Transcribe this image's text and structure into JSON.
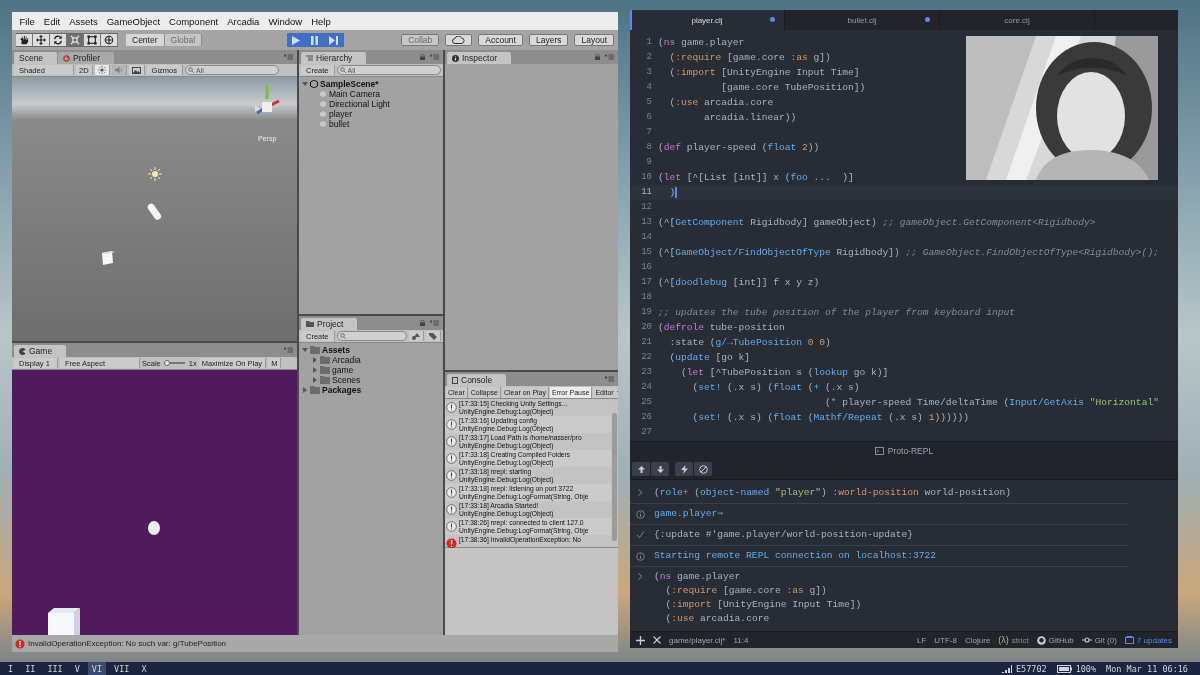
{
  "unity": {
    "menu": [
      "File",
      "Edit",
      "Assets",
      "GameObject",
      "Component",
      "Arcadia",
      "Window",
      "Help"
    ],
    "tools": [
      {
        "kind": "hand",
        "selected": false
      },
      {
        "kind": "move",
        "selected": false
      },
      {
        "kind": "rotate",
        "selected": false
      },
      {
        "kind": "scale",
        "selected": true
      },
      {
        "kind": "rect",
        "selected": false
      },
      {
        "kind": "transform",
        "selected": false
      }
    ],
    "pivot": [
      {
        "label": "Center",
        "disabled": false
      },
      {
        "label": "Global",
        "disabled": true
      }
    ],
    "playback": [
      {
        "kind": "play",
        "on": true
      },
      {
        "kind": "pause",
        "on": true
      },
      {
        "kind": "step",
        "on": true
      }
    ],
    "collab": {
      "label": "Collab",
      "disabled": true
    },
    "account": "Account",
    "layers": "Layers",
    "layout": "Layout",
    "scene": {
      "tabs": [
        {
          "label": "Scene",
          "selected": true
        },
        {
          "label": "Profiler",
          "selected": false
        }
      ],
      "shading": "Shaded",
      "mode_2d": "2D",
      "lighting_on": true,
      "audio_on": false,
      "gizmos": "Gizmos",
      "search": {
        "placeholder": "All"
      },
      "view_label": "Persp"
    },
    "hierarchy": {
      "title": "Hierarchy",
      "create": "Create",
      "search": {
        "placeholder": "All"
      },
      "items": [
        {
          "label": "SampleScene*",
          "expanded": true,
          "children": [
            {
              "label": "Main Camera"
            },
            {
              "label": "Directional Light"
            },
            {
              "label": "player"
            },
            {
              "label": "bullet"
            }
          ]
        }
      ]
    },
    "inspector": {
      "title": "Inspector"
    },
    "game": {
      "title": "Game",
      "display": "Display 1",
      "aspect": "Free Aspect",
      "scale_label": "Scale",
      "scale": {
        "level": 0
      },
      "scale_reading": "1x",
      "maximize": "Maximize On Play",
      "next_toggle": "M"
    },
    "project": {
      "title": "Project",
      "create": "Create",
      "items": [
        {
          "label": "Assets",
          "expanded": true,
          "children": [
            {
              "label": "Arcadia",
              "expanded": false
            },
            {
              "label": "game",
              "expanded": false
            },
            {
              "label": "Scenes",
              "expanded": false
            }
          ]
        },
        {
          "label": "Packages",
          "expanded": false
        }
      ]
    },
    "console": {
      "title": "Console",
      "buttons": [
        {
          "label": "Clear",
          "kind": "button",
          "selected": false
        },
        {
          "label": "Collapse",
          "kind": "button",
          "selected": false
        },
        {
          "label": "Clear on Play",
          "kind": "button",
          "selected": false
        },
        {
          "label": "Error Pause",
          "kind": "button",
          "selected": true
        },
        {
          "label": "Editor",
          "kind": "dropdown",
          "selected": false
        }
      ],
      "entries": [
        {
          "kind": "log",
          "message": "[17:33:15] Checking Unity Settings…",
          "source": "UnityEngine.Debug:Log(Object)"
        },
        {
          "kind": "log",
          "message": "[17:33:16] Updating config",
          "source": "UnityEngine.Debug:Log(Object)"
        },
        {
          "kind": "log",
          "message": "[17:33:17] Load Path is /home/nasser/pro",
          "source": "UnityEngine.Debug:Log(Object)"
        },
        {
          "kind": "log",
          "message": "[17:33:18] Creating Compiled Folders",
          "source": "UnityEngine.Debug:Log(Object)"
        },
        {
          "kind": "log",
          "message": "[17:33:18] nrepl: starting",
          "source": "UnityEngine.Debug:Log(Object)"
        },
        {
          "kind": "log",
          "message": "[17:33:18] nrepl: listening on port 3722",
          "source": "UnityEngine.Debug:LogFormat(String, Obje"
        },
        {
          "kind": "log",
          "message": "[17:33:18] Arcadia Started!",
          "source": "UnityEngine.Debug:Log(Object)"
        },
        {
          "kind": "log",
          "message": "[17:38:26] nrepl: connected to client 127.0",
          "source": "UnityEngine.Debug:LogFormat(String, Obje"
        },
        {
          "kind": "error",
          "message": "[17:38:36] InvalidOperationException: No"
        }
      ]
    },
    "status": {
      "kind": "error",
      "message": "InvalidOperationException: No such var: g/TubePosition"
    }
  },
  "atom": {
    "tabs": [
      {
        "label": "player.clj",
        "selected": true,
        "modified": true
      },
      {
        "label": "bullet.clj",
        "selected": false,
        "modified": true
      },
      {
        "label": "core.clj",
        "selected": false,
        "modified": false
      }
    ],
    "lines": [
      {
        "number": "1",
        "current": false,
        "tokens": [
          {
            "text": "(",
            "kind": "plain"
          },
          {
            "text": "ns",
            "kind": "keyword"
          },
          {
            "text": " game.player",
            "kind": "plain"
          }
        ]
      },
      {
        "number": "2",
        "current": false,
        "tokens": [
          {
            "text": "  (",
            "kind": "plain"
          },
          {
            "text": ":require",
            "kind": "symbol"
          },
          {
            "text": " [game.core ",
            "kind": "plain"
          },
          {
            "text": ":as",
            "kind": "symbol"
          },
          {
            "text": " g])",
            "kind": "plain"
          }
        ]
      },
      {
        "number": "3",
        "current": false,
        "tokens": [
          {
            "text": "  (",
            "kind": "plain"
          },
          {
            "text": ":import",
            "kind": "symbol"
          },
          {
            "text": " [UnityEngine Input Time]",
            "kind": "plain"
          }
        ]
      },
      {
        "number": "4",
        "current": false,
        "tokens": [
          {
            "text": "           [game.core TubePosition])",
            "kind": "plain"
          }
        ]
      },
      {
        "number": "5",
        "current": false,
        "tokens": [
          {
            "text": "  (",
            "kind": "plain"
          },
          {
            "text": ":use",
            "kind": "symbol"
          },
          {
            "text": " arcadia.core",
            "kind": "plain"
          }
        ]
      },
      {
        "number": "6",
        "current": false,
        "tokens": [
          {
            "text": "        arcadia.linear))",
            "kind": "plain"
          }
        ]
      },
      {
        "number": "7",
        "current": false
      },
      {
        "number": "8",
        "current": false,
        "tokens": [
          {
            "text": "(",
            "kind": "plain"
          },
          {
            "text": "def",
            "kind": "keyword"
          },
          {
            "text": " player-speed (",
            "kind": "plain"
          },
          {
            "text": "float ",
            "kind": "function"
          },
          {
            "text": "2",
            "kind": "number"
          },
          {
            "text": "))",
            "kind": "plain"
          }
        ]
      },
      {
        "number": "9",
        "current": false
      },
      {
        "number": "10",
        "current": false,
        "tokens": [
          {
            "text": "(",
            "kind": "plain"
          },
          {
            "text": "let",
            "kind": "keyword"
          },
          {
            "text": " [^[List [int]] x (",
            "kind": "plain"
          },
          {
            "text": "foo",
            "kind": "function"
          },
          {
            "text": " ...  )]",
            "kind": "plain"
          }
        ]
      },
      {
        "number": "11",
        "current": true,
        "tokens": [
          {
            "text": "  )",
            "kind": "plain"
          }
        ]
      },
      {
        "number": "12",
        "current": false
      },
      {
        "number": "13",
        "current": false,
        "tokens": [
          {
            "text": "(^[",
            "kind": "plain"
          },
          {
            "text": "GetComponent",
            "kind": "function"
          },
          {
            "text": " Rigidbody] gameObject) ",
            "kind": "plain"
          },
          {
            "text": ";; gameObject.GetComponent<Rigidbody>",
            "kind": "comment"
          }
        ]
      },
      {
        "number": "14",
        "current": false
      },
      {
        "number": "15",
        "current": false,
        "tokens": [
          {
            "text": "(^[",
            "kind": "plain"
          },
          {
            "text": "GameObject/FindObjectOfType",
            "kind": "function"
          },
          {
            "text": " Rigidbody]) ",
            "kind": "plain"
          },
          {
            "text": ";; GameObject.FindObjectOfType<Rigidbody>();",
            "kind": "comment"
          }
        ]
      },
      {
        "number": "16",
        "current": false
      },
      {
        "number": "17",
        "current": false,
        "tokens": [
          {
            "text": "(^[",
            "kind": "plain"
          },
          {
            "text": "doodlebug",
            "kind": "function"
          },
          {
            "text": " [int]] f x y z)",
            "kind": "plain"
          }
        ]
      },
      {
        "number": "18",
        "current": false
      },
      {
        "number": "19",
        "current": false,
        "tokens": [
          {
            "text": ";; updates the tube position of the player from keyboard input",
            "kind": "comment"
          }
        ]
      },
      {
        "number": "20",
        "current": false,
        "tokens": [
          {
            "text": "(",
            "kind": "plain"
          },
          {
            "text": "defrole",
            "kind": "keyword"
          },
          {
            "text": " tube-position",
            "kind": "plain"
          }
        ]
      },
      {
        "number": "21",
        "current": false,
        "tokens": [
          {
            "text": "  :state (",
            "kind": "plain"
          },
          {
            "text": "g/→TubePosition ",
            "kind": "function"
          },
          {
            "text": "0 0",
            "kind": "number"
          },
          {
            "text": ")",
            "kind": "plain"
          }
        ]
      },
      {
        "number": "22",
        "current": false,
        "tokens": [
          {
            "text": "  (",
            "kind": "plain"
          },
          {
            "text": "update",
            "kind": "function"
          },
          {
            "text": " [go k]",
            "kind": "plain"
          }
        ]
      },
      {
        "number": "23",
        "current": false,
        "tokens": [
          {
            "text": "    (",
            "kind": "plain"
          },
          {
            "text": "let",
            "kind": "keyword"
          },
          {
            "text": " [^TubePosition s (",
            "kind": "plain"
          },
          {
            "text": "lookup",
            "kind": "function"
          },
          {
            "text": " go k)]",
            "kind": "plain"
          }
        ]
      },
      {
        "number": "24",
        "current": false,
        "tokens": [
          {
            "text": "      (",
            "kind": "plain"
          },
          {
            "text": "set!",
            "kind": "function"
          },
          {
            "text": " (.x s) (",
            "kind": "plain"
          },
          {
            "text": "float",
            "kind": "function"
          },
          {
            "text": " (",
            "kind": "plain"
          },
          {
            "text": "+",
            "kind": "function"
          },
          {
            "text": " (.x s)",
            "kind": "plain"
          }
        ]
      },
      {
        "number": "25",
        "current": false,
        "tokens": [
          {
            "text": "                             (",
            "kind": "plain"
          },
          {
            "text": "*",
            "kind": "function"
          },
          {
            "text": " player-speed Time/deltaTime (",
            "kind": "plain"
          },
          {
            "text": "Input/GetAxis ",
            "kind": "function"
          },
          {
            "text": "\"Horizontal\"",
            "kind": "string"
          }
        ]
      },
      {
        "number": "26",
        "current": false,
        "tokens": [
          {
            "text": "      (",
            "kind": "plain"
          },
          {
            "text": "set!",
            "kind": "function"
          },
          {
            "text": " (.x s) (",
            "kind": "plain"
          },
          {
            "text": "float",
            "kind": "function"
          },
          {
            "text": " (",
            "kind": "plain"
          },
          {
            "text": "Mathf/Repeat",
            "kind": "function"
          },
          {
            "text": " (.x s) ",
            "kind": "plain"
          },
          {
            "text": "1",
            "kind": "number"
          },
          {
            "text": "))))))",
            "kind": "plain"
          }
        ]
      },
      {
        "number": "27",
        "current": false
      }
    ],
    "repl": {
      "title": "Proto-REPL",
      "buttons": [
        {
          "kind": "up"
        },
        {
          "kind": "down"
        },
        {
          "kind": "execute"
        },
        {
          "kind": "cancel"
        }
      ],
      "entries": [
        {
          "kind": "input",
          "lines": [
            [
              {
                "text": "(",
                "kind": "plain"
              },
              {
                "text": "role+",
                "kind": "function"
              },
              {
                "text": " (",
                "kind": "plain"
              },
              {
                "text": "object-named ",
                "kind": "function"
              },
              {
                "text": "\"player\"",
                "kind": "string"
              },
              {
                "text": ") ",
                "kind": "plain"
              },
              {
                "text": ":world-position",
                "kind": "symbol"
              },
              {
                "text": " world-position)",
                "kind": "plain"
              }
            ]
          ]
        },
        {
          "kind": "info",
          "lines": [
            [
              {
                "text": "game.player⇒",
                "kind": "plain"
              }
            ]
          ]
        },
        {
          "kind": "result",
          "lines": [
            [
              {
                "text": "{:update #'game.player/world-position-update}",
                "kind": "plain"
              }
            ]
          ]
        },
        {
          "kind": "info",
          "lines": [
            [
              {
                "text": "Starting remote REPL connection on localhost:3722",
                "kind": "plain"
              }
            ]
          ]
        },
        {
          "kind": "input",
          "lines": [
            [
              {
                "text": "(",
                "kind": "plain"
              },
              {
                "text": "ns",
                "kind": "keyword"
              },
              {
                "text": " game.player",
                "kind": "plain"
              }
            ],
            [
              {
                "text": "  (",
                "kind": "plain"
              },
              {
                "text": ":require",
                "kind": "symbol"
              },
              {
                "text": " [game.core ",
                "kind": "plain"
              },
              {
                "text": ":as",
                "kind": "symbol"
              },
              {
                "text": " g])",
                "kind": "plain"
              }
            ],
            [
              {
                "text": "  (",
                "kind": "plain"
              },
              {
                "text": ":import",
                "kind": "symbol"
              },
              {
                "text": " [UnityEngine Input Time])",
                "kind": "plain"
              }
            ],
            [
              {
                "text": "  (",
                "kind": "plain"
              },
              {
                "text": ":use",
                "kind": "symbol"
              },
              {
                "text": " arcadia.core",
                "kind": "plain"
              }
            ]
          ]
        }
      ]
    },
    "status": {
      "file": "game/player.clj*",
      "cursor": "11:4",
      "line_ending": "LF",
      "encoding": "UTF-8",
      "grammar": "Clojure",
      "lambda": "(λ)",
      "mode": "strict",
      "github": "GitHub",
      "git": "Git (0)",
      "updates": "7 updates"
    }
  },
  "taskbar": {
    "workspaces": [
      {
        "label": "I",
        "selected": false
      },
      {
        "label": "II",
        "selected": false
      },
      {
        "label": "III",
        "selected": false
      },
      {
        "label": "V",
        "selected": false
      },
      {
        "label": "VI",
        "selected": true
      },
      {
        "label": "VII",
        "selected": false
      },
      {
        "label": "X",
        "selected": false
      }
    ],
    "network": "E57702",
    "battery": "100%",
    "clock": "Mon Mar 11 06:16"
  }
}
